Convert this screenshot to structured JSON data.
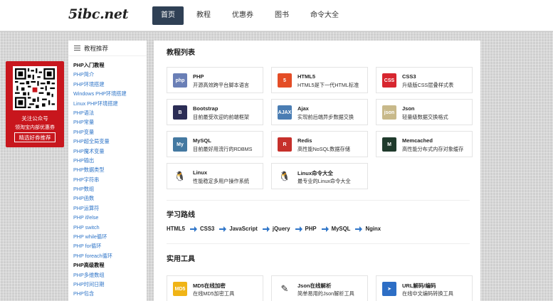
{
  "logo": "5ibc.net",
  "nav": [
    "首页",
    "教程",
    "优惠券",
    "图书",
    "命令大全"
  ],
  "qr": {
    "line1": "关注公众号",
    "line2": "领淘宝内部优惠券",
    "button": "精选好券推荐"
  },
  "sidebar": {
    "title": "教程推荐",
    "items": [
      {
        "label": "PHP入门教程",
        "head": true
      },
      {
        "label": "PHP简介"
      },
      {
        "label": "PHP环境搭建"
      },
      {
        "label": "Windows PHP环境搭建"
      },
      {
        "label": "Linux PHP环境搭建"
      },
      {
        "label": "PHP语法"
      },
      {
        "label": "PHP常量"
      },
      {
        "label": "PHP变量"
      },
      {
        "label": "PHP超全局变量"
      },
      {
        "label": "PHP魔术变量"
      },
      {
        "label": "PHP输出"
      },
      {
        "label": "PHP数据类型"
      },
      {
        "label": "PHP字符串"
      },
      {
        "label": "PHP数组"
      },
      {
        "label": "PHP函数"
      },
      {
        "label": "PHP运算符"
      },
      {
        "label": "PHP if/else"
      },
      {
        "label": "PHP switch"
      },
      {
        "label": "PHP while循环"
      },
      {
        "label": "PHP for循环"
      },
      {
        "label": "PHP foreach循环"
      },
      {
        "label": "PHP高级教程",
        "head": true
      },
      {
        "label": "PHP多维数组"
      },
      {
        "label": "PHP时间日期"
      },
      {
        "label": "PHP包含"
      }
    ]
  },
  "main": {
    "tutorials_title": "教程列表",
    "tutorials": [
      {
        "name": "PHP",
        "desc": "开源高效跨平台脚本语言",
        "icon": "php-icon",
        "icon_text": "php",
        "color": "#6a7fb6"
      },
      {
        "name": "HTML5",
        "desc": "HTML5是下一代HTML标准",
        "icon": "html5-icon",
        "icon_text": "5",
        "color": "#e44d26"
      },
      {
        "name": "CSS3",
        "desc": "升级版CSS层叠样式表",
        "icon": "css3-icon",
        "icon_text": "CSS",
        "color": "#d7262f"
      },
      {
        "name": "Bootstrap",
        "desc": "目前最受欢迎的前端框架",
        "icon": "bootstrap-icon",
        "icon_text": "B",
        "color": "#2b2d55"
      },
      {
        "name": "Ajax",
        "desc": "实现前后端异步数据交换",
        "icon": "ajax-icon",
        "icon_text": "AJAX",
        "color": "#4a7db3"
      },
      {
        "name": "Json",
        "desc": "轻量级数据交换格式",
        "icon": "json-icon",
        "icon_text": "json",
        "color": "#c8b98a"
      },
      {
        "name": "MySQL",
        "desc": "目前最好用流行的RDBMS",
        "icon": "mysql-icon",
        "icon_text": "My",
        "color": "#4479a1"
      },
      {
        "name": "Redis",
        "desc": "高性能NoSQL数据存储",
        "icon": "redis-icon",
        "icon_text": "R",
        "color": "#c6302b"
      },
      {
        "name": "Memcached",
        "desc": "高性能分布式内存对象缓存",
        "icon": "memcached-icon",
        "icon_text": "M",
        "color": "#1f3a2c"
      },
      {
        "name": "Linux",
        "desc": "性能稳定多用户操作系统",
        "icon": "linux-icon",
        "icon_text": "🐧",
        "color": "#ffffff"
      },
      {
        "name": "Linux命令大全",
        "desc": "最专业的Linux命令大全",
        "icon": "linux-command-icon",
        "icon_text": "🐧",
        "color": "#ffffff"
      }
    ],
    "path_title": "学习路线",
    "path": [
      "HTML5",
      "CSS3",
      "JavaScript",
      "jQuery",
      "PHP",
      "MySQL",
      "Nginx"
    ],
    "tools_title": "实用工具",
    "tools": [
      {
        "name": "MD5在线加密",
        "desc": "在线MD5加密工具",
        "icon": "md5-icon",
        "icon_text": "MD5",
        "color": "#f0b416"
      },
      {
        "name": "Json在线解析",
        "desc": "简单易用的Json解析工具",
        "icon": "json-parse-icon",
        "icon_text": "✎",
        "color": "#ffffff"
      },
      {
        "name": "URL解码/编码",
        "desc": "在线中文编码转换工具",
        "icon": "url-codec-icon",
        "icon_text": "➤",
        "color": "#2d6ec5"
      }
    ]
  },
  "colors": {
    "nav_active": "#2f4055",
    "link": "#2f75c8",
    "qr_panel": "#c8161d",
    "arrow": "#2f75c8"
  }
}
